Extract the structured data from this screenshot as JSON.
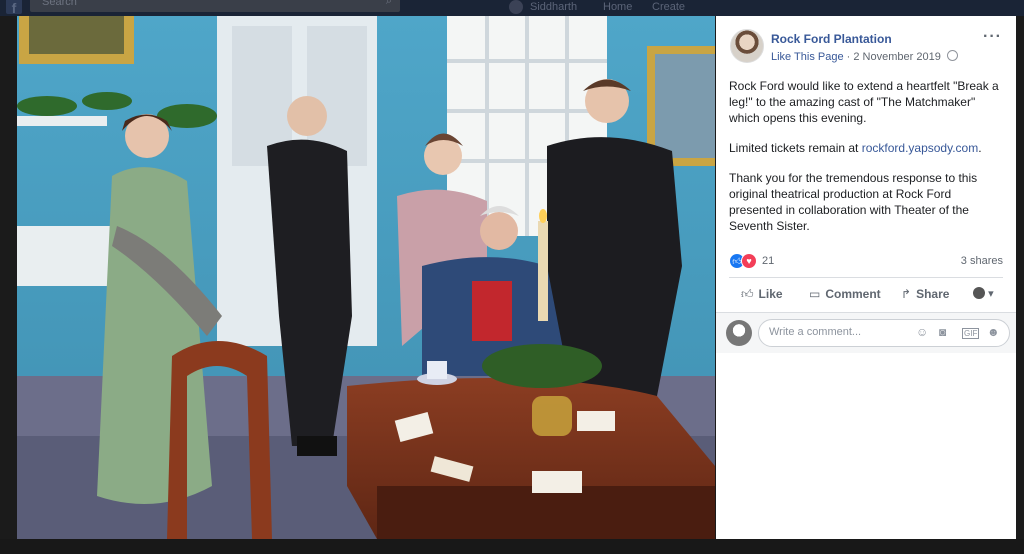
{
  "nav": {
    "search_placeholder": "Search",
    "user_name": "Siddharth",
    "home_label": "Home",
    "create_label": "Create"
  },
  "post": {
    "page_name": "Rock Ford Plantation",
    "like_page_label": "Like This Page",
    "separator": "·",
    "date": "2 November 2019",
    "paragraph1": "Rock Ford would like to extend a heartfelt \"Break a leg!\" to the amazing cast of \"The Matchmaker\" which opens this evening.",
    "paragraph2_prefix": "Limited tickets remain at ",
    "paragraph2_link": "rockford.yapsody.com",
    "paragraph2_suffix": ".",
    "paragraph3": "Thank you for the tremendous response to this original theatrical production at Rock Ford presented in collaboration with Theater of the Seventh Sister.",
    "reaction_count": "21",
    "shares": "3 shares"
  },
  "actions": {
    "like": "Like",
    "comment": "Comment",
    "share": "Share"
  },
  "comment": {
    "placeholder": "Write a comment..."
  },
  "icons": {
    "globe": "globe-icon",
    "more": "more-icon",
    "like": "thumbs-up-icon",
    "comment": "speech-bubble-icon",
    "share": "share-arrow-icon",
    "emoji": "emoji-icon",
    "camera": "camera-icon",
    "gif": "gif-icon",
    "sticker": "sticker-icon"
  },
  "colors": {
    "link_blue": "#385898",
    "like_blue": "#1877f2",
    "love_red": "#f33e58"
  }
}
